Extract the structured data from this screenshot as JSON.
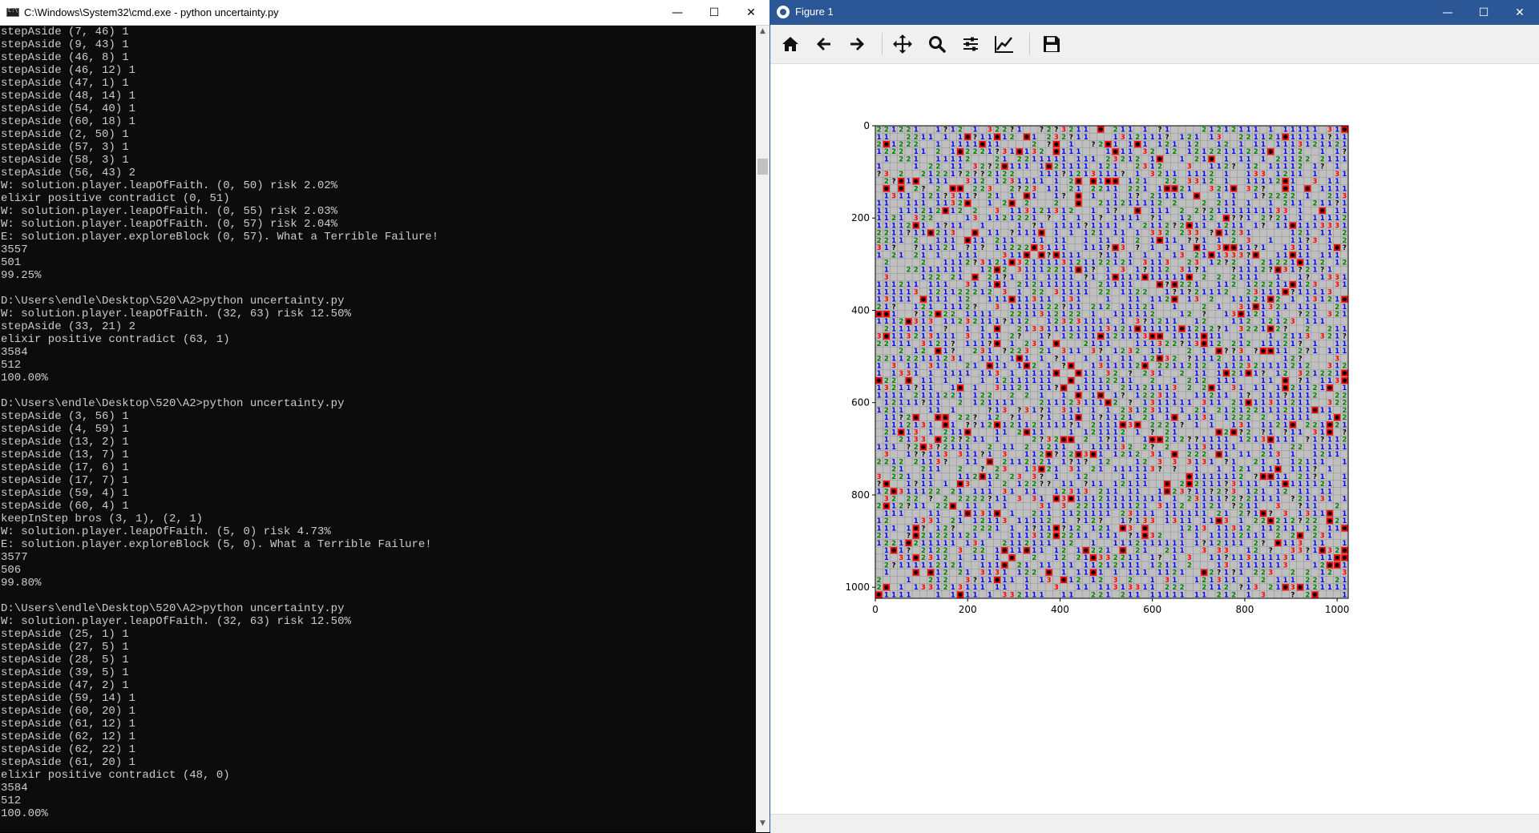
{
  "cmd_window": {
    "title": "C:\\Windows\\System32\\cmd.exe - python  uncertainty.py",
    "controls": {
      "minimize": "—",
      "maximize": "☐",
      "close": "✕"
    },
    "lines": [
      "stepAside (7, 46) 1",
      "stepAside (9, 43) 1",
      "stepAside (46, 8) 1",
      "stepAside (46, 12) 1",
      "stepAside (47, 1) 1",
      "stepAside (48, 14) 1",
      "stepAside (54, 40) 1",
      "stepAside (60, 18) 1",
      "stepAside (2, 50) 1",
      "stepAside (57, 3) 1",
      "stepAside (58, 3) 1",
      "stepAside (56, 43) 2",
      "W: solution.player.leapOfFaith. (0, 50) risk 2.02%",
      "elixir positive contradict (0, 51)",
      "W: solution.player.leapOfFaith. (0, 55) risk 2.03%",
      "W: solution.player.leapOfFaith. (0, 57) risk 2.04%",
      "E: solution.player.exploreBlock (0, 57). What a Terrible Failure!",
      "3557",
      "501",
      "99.25%",
      "",
      "D:\\Users\\endle\\Desktop\\520\\A2>python uncertainty.py",
      "W: solution.player.leapOfFaith. (32, 63) risk 12.50%",
      "stepAside (33, 21) 2",
      "elixir positive contradict (63, 1)",
      "3584",
      "512",
      "100.00%",
      "",
      "D:\\Users\\endle\\Desktop\\520\\A2>python uncertainty.py",
      "stepAside (3, 56) 1",
      "stepAside (4, 59) 1",
      "stepAside (13, 2) 1",
      "stepAside (13, 7) 1",
      "stepAside (17, 6) 1",
      "stepAside (17, 7) 1",
      "stepAside (59, 4) 1",
      "stepAside (60, 4) 1",
      "keepInStep bros (3, 1), (2, 1)",
      "W: solution.player.leapOfFaith. (5, 0) risk 4.73%",
      "E: solution.player.exploreBlock (5, 0). What a Terrible Failure!",
      "3577",
      "506",
      "99.80%",
      "",
      "D:\\Users\\endle\\Desktop\\520\\A2>python uncertainty.py",
      "W: solution.player.leapOfFaith. (32, 63) risk 12.50%",
      "stepAside (25, 1) 1",
      "stepAside (27, 5) 1",
      "stepAside (28, 5) 1",
      "stepAside (39, 5) 1",
      "stepAside (47, 2) 1",
      "stepAside (59, 14) 1",
      "stepAside (60, 20) 1",
      "stepAside (61, 12) 1",
      "stepAside (62, 12) 1",
      "stepAside (62, 22) 1",
      "stepAside (61, 20) 1",
      "elixir positive contradict (48, 0)",
      "3584",
      "512",
      "100.00%"
    ]
  },
  "figure_window": {
    "title": "Figure 1",
    "controls": {
      "minimize": "—",
      "maximize": "☐",
      "close": "✕"
    },
    "toolbar": [
      {
        "name": "home-icon"
      },
      {
        "name": "back-arrow-icon"
      },
      {
        "name": "forward-arrow-icon"
      },
      {
        "name": "pan-move-icon"
      },
      {
        "name": "zoom-magnifier-icon"
      },
      {
        "name": "configure-subplots-icon"
      },
      {
        "name": "edit-axis-icon"
      },
      {
        "name": "save-disk-icon"
      }
    ]
  },
  "chart_data": {
    "type": "heatmap",
    "description_of_content": "",
    "grid_rows": 64,
    "grid_cols": 64,
    "xlim": [
      0,
      1024
    ],
    "ylim": [
      1024,
      0
    ],
    "xticks": [
      "0",
      "200",
      "400",
      "600",
      "800",
      "1000"
    ],
    "yticks": [
      "0",
      "200",
      "400",
      "600",
      "800",
      "1000"
    ],
    "xtick_values": [
      0,
      200,
      400,
      600,
      800,
      1000
    ],
    "ytick_values": [
      0,
      200,
      400,
      600,
      800,
      1000
    ],
    "colors": {
      "unrevealed": "#c0c0c0",
      "revealed": "#bdbdbd",
      "gridline": "#7b7b7b",
      "one": "#0000ff",
      "two": "#008000",
      "three": "#ff0000",
      "mine_bg": "#ff0000",
      "question": "#000000"
    }
  }
}
